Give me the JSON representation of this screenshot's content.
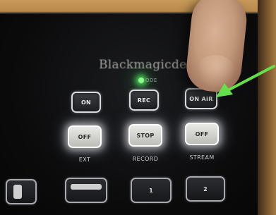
{
  "device": {
    "brand": "Blackmagicdes",
    "status_led_label": "ODE"
  },
  "top_row": [
    {
      "label": "ON",
      "name": "on-button"
    },
    {
      "label": "REC",
      "name": "rec-button"
    },
    {
      "label": "ON AIR",
      "name": "on-air-button"
    }
  ],
  "middle_row": [
    {
      "label": "OFF",
      "caption": "EXT"
    },
    {
      "label": "STOP",
      "caption": "RECORD"
    },
    {
      "label": "OFF",
      "caption": "STREAM"
    }
  ],
  "bottom_row": [
    {
      "label": "",
      "name": "toggle-button"
    },
    {
      "label": "",
      "name": "bar-button"
    },
    {
      "label": "1",
      "name": "button-1"
    },
    {
      "label": "2",
      "name": "button-2"
    }
  ],
  "colors": {
    "led": "#8dff8a",
    "arrow": "#63e04a"
  }
}
